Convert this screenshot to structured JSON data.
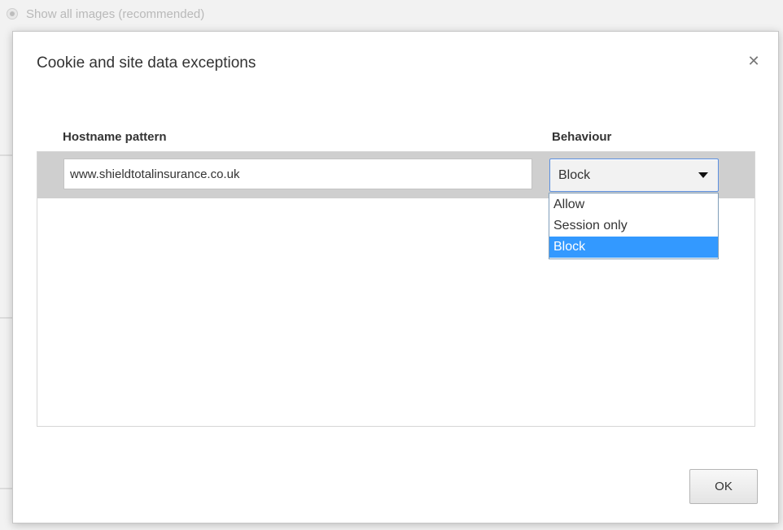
{
  "background": {
    "option_label": "Show all images (recommended)"
  },
  "dialog": {
    "title": "Cookie and site data exceptions",
    "close_icon": "close-icon",
    "columns": {
      "hostname": "Hostname pattern",
      "behaviour": "Behaviour"
    },
    "rows": [
      {
        "hostname": "www.shieldtotalinsurance.co.uk",
        "behaviour": "Block"
      }
    ],
    "behaviour_options": [
      "Allow",
      "Session only",
      "Block"
    ],
    "selected_option": "Block",
    "ok_label": "OK"
  },
  "colors": {
    "selection": "#3399ff",
    "select_border": "#5b8fe0",
    "row_background": "#cfcfcf"
  }
}
